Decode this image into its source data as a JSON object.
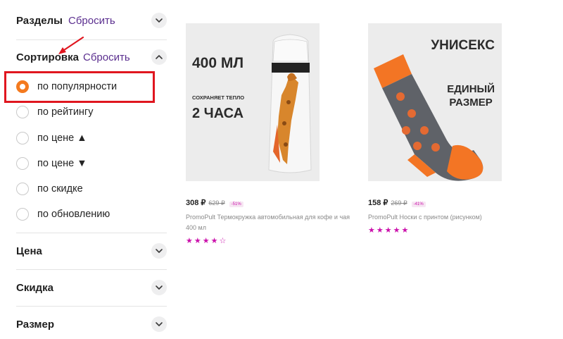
{
  "filters": {
    "sections": {
      "title": "Разделы",
      "reset_label": "Сбросить"
    },
    "sort": {
      "title": "Сортировка",
      "reset_label": "Сбросить",
      "options": [
        {
          "label": "по популярности",
          "selected": true
        },
        {
          "label": "по рейтингу",
          "selected": false
        },
        {
          "label": "по цене ▲",
          "selected": false
        },
        {
          "label": "по цене ▼",
          "selected": false
        },
        {
          "label": "по скидке",
          "selected": false
        },
        {
          "label": "по обновлению",
          "selected": false
        }
      ]
    },
    "price": {
      "title": "Цена"
    },
    "discount": {
      "title": "Скидка"
    },
    "size": {
      "title": "Размер"
    }
  },
  "products": [
    {
      "price": "308 ₽",
      "old_price": "629 ₽",
      "discount": "-51%",
      "name": "PromoPult Термокружка автомобильная для кофе и чая 400 мл",
      "rating_stars": 4,
      "image_text": {
        "volume": "400 МЛ",
        "keeps": "СОХРАНЯЕТ ТЕПЛО",
        "hours": "2 ЧАСА"
      }
    },
    {
      "price": "158 ₽",
      "old_price": "269 ₽",
      "discount": "-41%",
      "name": "PromoPult Носки с принтом (рисунком)",
      "rating_stars": 5,
      "image_text": {
        "unisex": "УНИСЕКС",
        "size_line1": "ЕДИНЫЙ",
        "size_line2": "РАЗМЕР"
      }
    }
  ],
  "annotation": {
    "highlight_color": "#e0161f"
  },
  "colors": {
    "accent": "#5b2f8f",
    "radio_active": "#f47a1f",
    "stars": "#cb11ab"
  },
  "icons": [
    "chevron-down-icon",
    "chevron-up-icon",
    "annotation-arrow-icon"
  ]
}
